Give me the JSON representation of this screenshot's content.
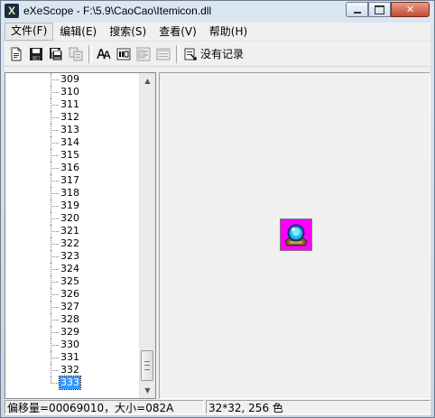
{
  "window": {
    "title": "eXeScope - F:\\5.9\\CaoCao\\Itemicon.dll",
    "app_icon_letter": "X",
    "caption_buttons": [
      "minimize",
      "maximize",
      "close"
    ],
    "close_glyph": "✕"
  },
  "menu": {
    "items": [
      {
        "label": "文件(F)"
      },
      {
        "label": "编辑(E)"
      },
      {
        "label": "搜索(S)"
      },
      {
        "label": "查看(V)"
      },
      {
        "label": "帮助(H)"
      }
    ]
  },
  "toolbar": {
    "icons": [
      "new-file-icon",
      "save-icon",
      "save-all-icon",
      "copy-disabled-icon",
      "font-icon",
      "id-icon",
      "dialog-disabled-icon",
      "menu-disabled-icon"
    ],
    "history_label": "没有记录"
  },
  "tree": {
    "items": [
      "309",
      "310",
      "311",
      "312",
      "313",
      "314",
      "315",
      "316",
      "317",
      "318",
      "319",
      "320",
      "321",
      "322",
      "323",
      "324",
      "325",
      "326",
      "327",
      "328",
      "329",
      "330",
      "331",
      "332",
      "333"
    ],
    "selected": "333"
  },
  "scrollbar": {
    "up_glyph": "▲",
    "down_glyph": "▼"
  },
  "preview": {
    "background_color": "#ff00ff",
    "icon": "crystal-ball-icon"
  },
  "status": {
    "offset_size": "偏移量=00069010，大小=082A",
    "image_info": "32*32, 256 色"
  },
  "colors": {
    "selection": "#3399ff",
    "magenta": "#ff00ff",
    "close_button": "#c64b33"
  }
}
